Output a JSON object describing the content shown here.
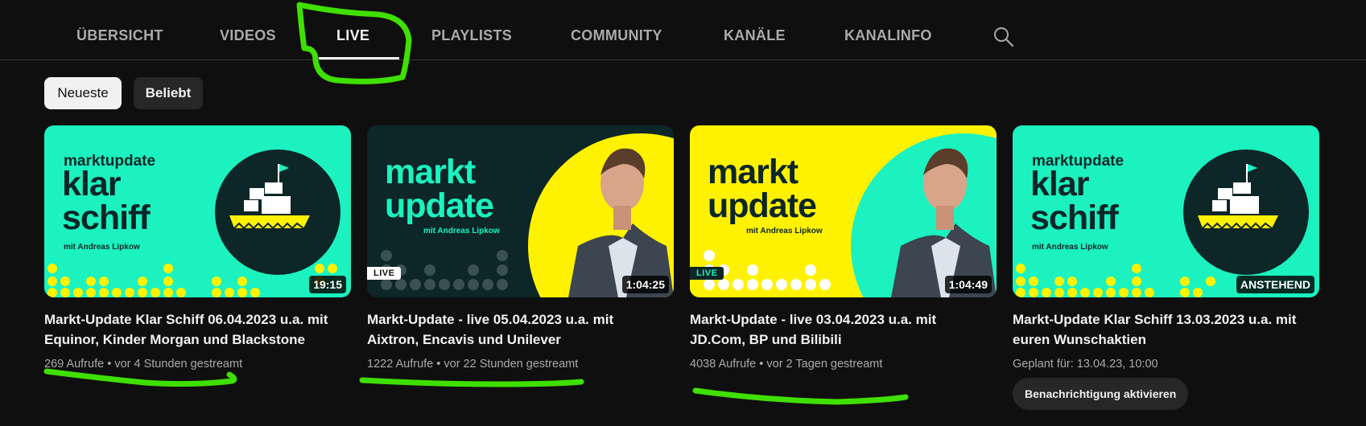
{
  "tabs": [
    "ÜBERSICHT",
    "VIDEOS",
    "LIVE",
    "PLAYLISTS",
    "COMMUNITY",
    "KANÄLE",
    "KANALINFO"
  ],
  "search": {
    "icon": "search-icon"
  },
  "filters": {
    "selected": "Neueste",
    "other": "Beliebt"
  },
  "videos": [
    {
      "thumb": {
        "brand": "marktupdate",
        "line1": "klar",
        "line2": "schiff",
        "sub": "mit Andreas Lipkow"
      },
      "badge": "19:15",
      "title_line1": "Markt-Update Klar Schiff 06.04.2023 u.a. mit",
      "title_line2": "Equinor, Kinder Morgan und Blackstone",
      "views": "269 Aufrufe",
      "age": "vor 4 Stunden gestreamt"
    },
    {
      "thumb": {
        "line1": "markt",
        "line2": "update",
        "sub": "mit Andreas Lipkow"
      },
      "live_badge": "LIVE",
      "badge": "1:04:25",
      "title_line1": "Markt-Update - live 05.04.2023 u.a. mit",
      "title_line2": "Aixtron, Encavis und Unilever",
      "views": "1222 Aufrufe",
      "age": "vor 22 Stunden gestreamt"
    },
    {
      "thumb": {
        "line1": "markt",
        "line2": "update",
        "sub": "mit Andreas Lipkow"
      },
      "live_badge": "LIVE",
      "badge": "1:04:49",
      "title_line1": "Markt-Update - live 03.04.2023 u.a. mit",
      "title_line2": "JD.Com, BP und Bilibili",
      "views": "4038 Aufrufe",
      "age": "vor 2 Tagen gestreamt"
    },
    {
      "thumb": {
        "brand": "marktupdate",
        "line1": "klar",
        "line2": "schiff",
        "sub": "mit Andreas Lipkow"
      },
      "badge": "ANSTEHEND",
      "title_line1": "Markt-Update Klar Schiff 13.03.2023 u.a. mit",
      "title_line2": "euren Wunschaktien",
      "scheduled": "Geplant für: 13.04.23, 10:00",
      "notify_button": "Benachrichtigung aktivieren"
    }
  ],
  "colors": {
    "background": "#0f0f0f",
    "accent_mint": "#1bf2c0",
    "accent_yellow": "#fff200",
    "annotation": "#3fe000"
  }
}
